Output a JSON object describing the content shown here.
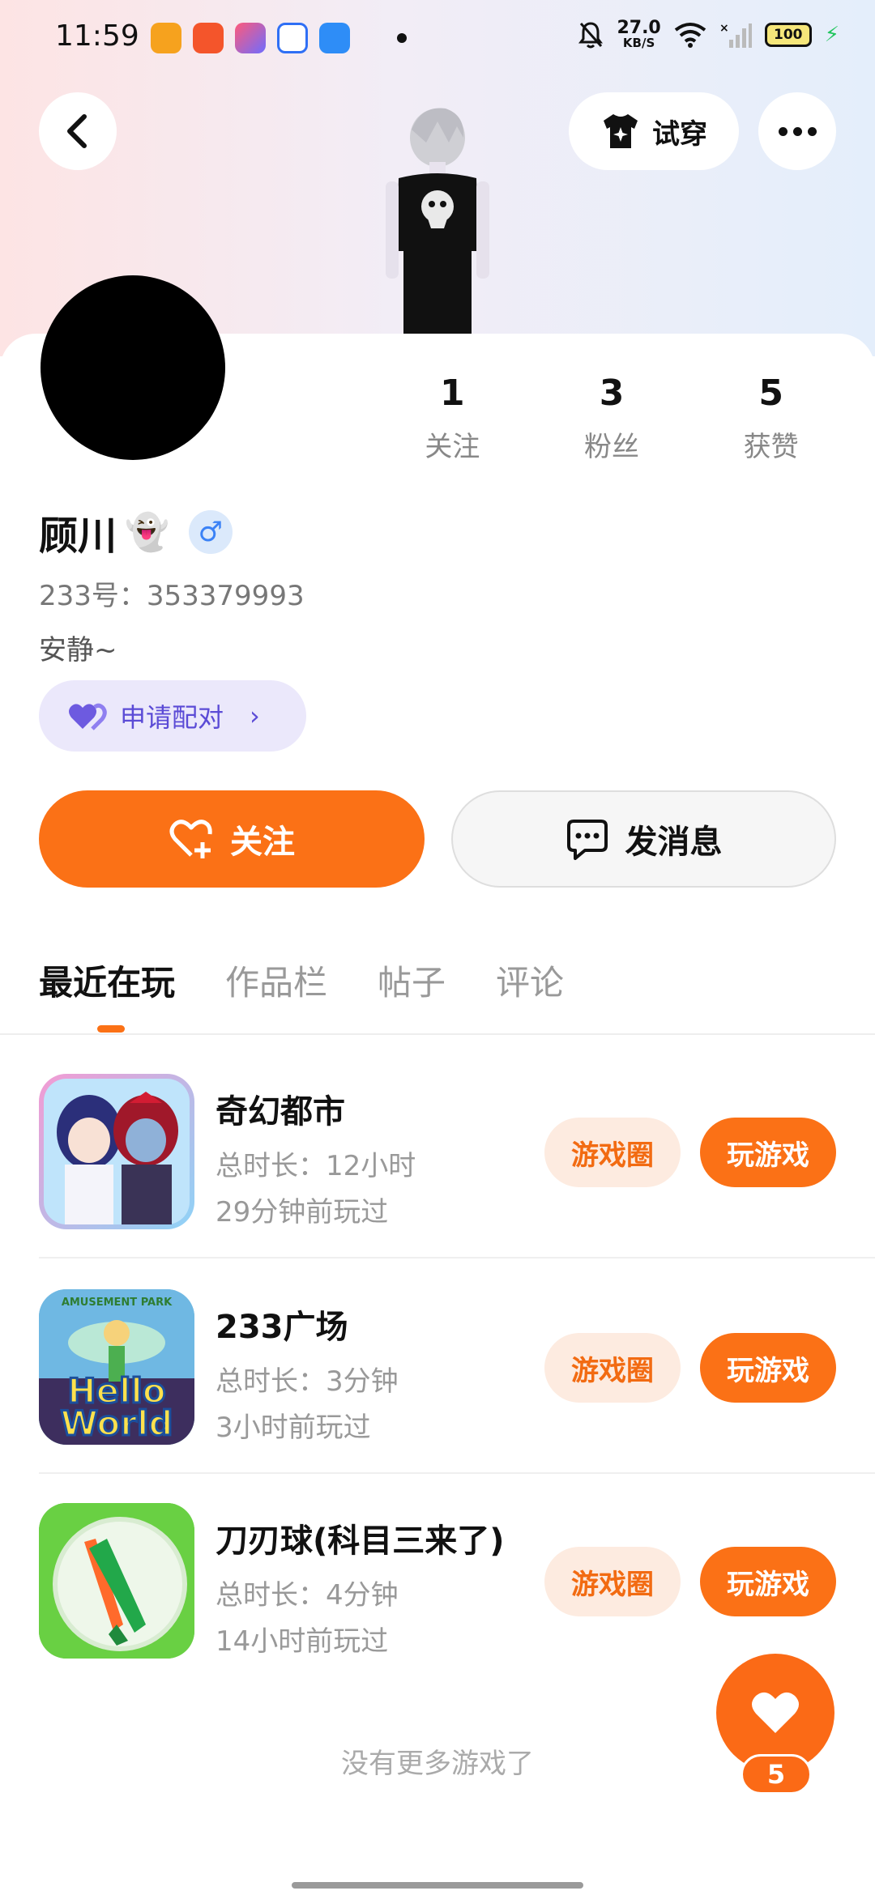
{
  "status_bar": {
    "time": "11:59",
    "net_speed_value": "27.0",
    "net_speed_unit": "KB/S",
    "battery": "100",
    "app_icons": [
      "weibo-icon",
      "kuaishou-icon",
      "paint-icon",
      "baidu-icon",
      "feather-icon"
    ]
  },
  "header": {
    "try_on_label": "试穿"
  },
  "profile": {
    "name": "顾川",
    "name_emoji": "👻",
    "gender_symbol": "♂",
    "uid": "233号：353379993",
    "bio": "安静~",
    "match_label": "申请配对",
    "stats": [
      {
        "value": "1",
        "label": "关注"
      },
      {
        "value": "3",
        "label": "粉丝"
      },
      {
        "value": "5",
        "label": "获赞"
      }
    ]
  },
  "actions": {
    "follow_label": "关注",
    "message_label": "发消息"
  },
  "tabs": [
    "最近在玩",
    "作品栏",
    "帖子",
    "评论"
  ],
  "games": [
    {
      "title": "奇幻都市",
      "duration": "总时长：12小时",
      "last_played": "29分钟前玩过",
      "circle_label": "游戏圈",
      "play_label": "玩游戏"
    },
    {
      "title": "233广场",
      "duration": "总时长：3分钟",
      "last_played": "3小时前玩过",
      "circle_label": "游戏圈",
      "play_label": "玩游戏"
    },
    {
      "title": "刀刃球(科目三来了)",
      "duration": "总时长：4分钟",
      "last_played": "14小时前玩过",
      "circle_label": "游戏圈",
      "play_label": "玩游戏"
    }
  ],
  "game_icon_texts": {
    "hello_world_top": "AMUSEMENT PARK",
    "hello_world_main1": "Hello",
    "hello_world_main2": "World"
  },
  "footer": {
    "no_more": "没有更多游戏了",
    "like_count": "5"
  },
  "colors": {
    "accent": "#fb7116",
    "match_bg": "#ebe8fb",
    "match_text": "#5b4bd6"
  }
}
